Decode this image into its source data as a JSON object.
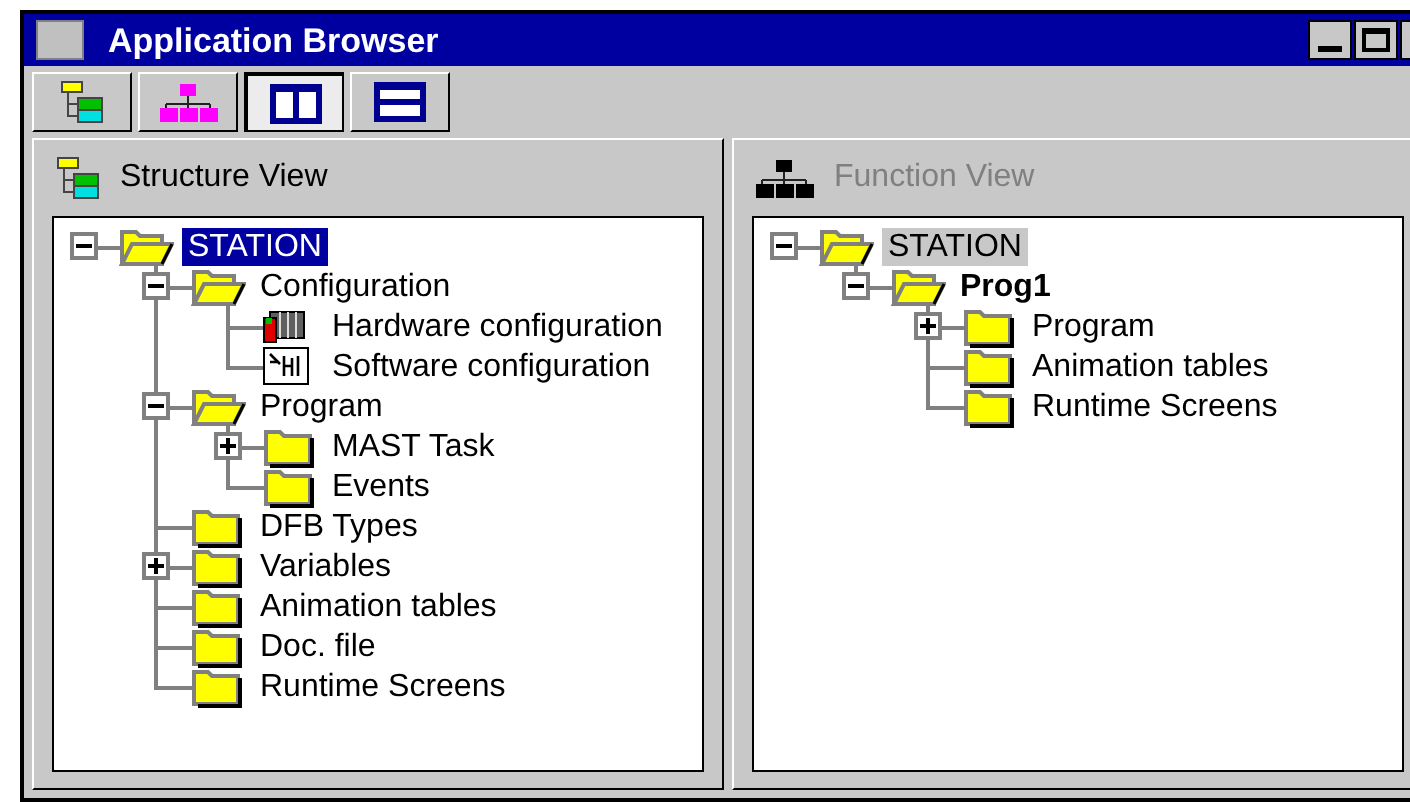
{
  "window": {
    "title": "Application Browser"
  },
  "toolbar": [
    {
      "kind": "structure",
      "pressed": false
    },
    {
      "kind": "function",
      "pressed": false
    },
    {
      "kind": "split",
      "pressed": true
    },
    {
      "kind": "stacked",
      "pressed": false
    }
  ],
  "panes": [
    {
      "title": "Structure View",
      "kind": "structure",
      "active": true,
      "tree": [
        {
          "label": "STATION",
          "kind": "folder",
          "selected": true,
          "expanded": true,
          "children": [
            {
              "label": "Configuration",
              "kind": "folder",
              "selected": false,
              "expanded": true,
              "children": [
                {
                  "label": "Hardware configuration",
                  "kind": "hardware",
                  "selected": false
                },
                {
                  "label": "Software configuration",
                  "kind": "software",
                  "selected": false
                }
              ]
            },
            {
              "label": "Program",
              "kind": "folder",
              "selected": false,
              "expanded": true,
              "children": [
                {
                  "label": "MAST Task",
                  "kind": "folder",
                  "selected": false,
                  "expanded": false
                },
                {
                  "label": "Events",
                  "kind": "folder",
                  "selected": false
                }
              ]
            },
            {
              "label": "DFB Types",
              "kind": "folder",
              "selected": false
            },
            {
              "label": "Variables",
              "kind": "folder",
              "selected": false,
              "expanded": false
            },
            {
              "label": "Animation tables",
              "kind": "folder",
              "selected": false
            },
            {
              "label": "Doc. file",
              "kind": "folder",
              "selected": false
            },
            {
              "label": "Runtime Screens",
              "kind": "folder",
              "selected": false
            }
          ]
        }
      ]
    },
    {
      "title": "Function View",
      "kind": "function",
      "active": false,
      "tree": [
        {
          "label": "STATION",
          "kind": "folder",
          "selected": true,
          "bold": false,
          "expanded": true,
          "children": [
            {
              "label": "Prog1",
              "kind": "folder",
              "selected": false,
              "bold": true,
              "expanded": true,
              "children": [
                {
                  "label": "Program",
                  "kind": "folder",
                  "selected": false,
                  "bold": false,
                  "expanded": false
                },
                {
                  "label": "Animation tables",
                  "kind": "folder",
                  "selected": false,
                  "bold": false
                },
                {
                  "label": "Runtime Screens",
                  "kind": "folder",
                  "selected": false,
                  "bold": false
                }
              ]
            }
          ]
        }
      ]
    }
  ]
}
